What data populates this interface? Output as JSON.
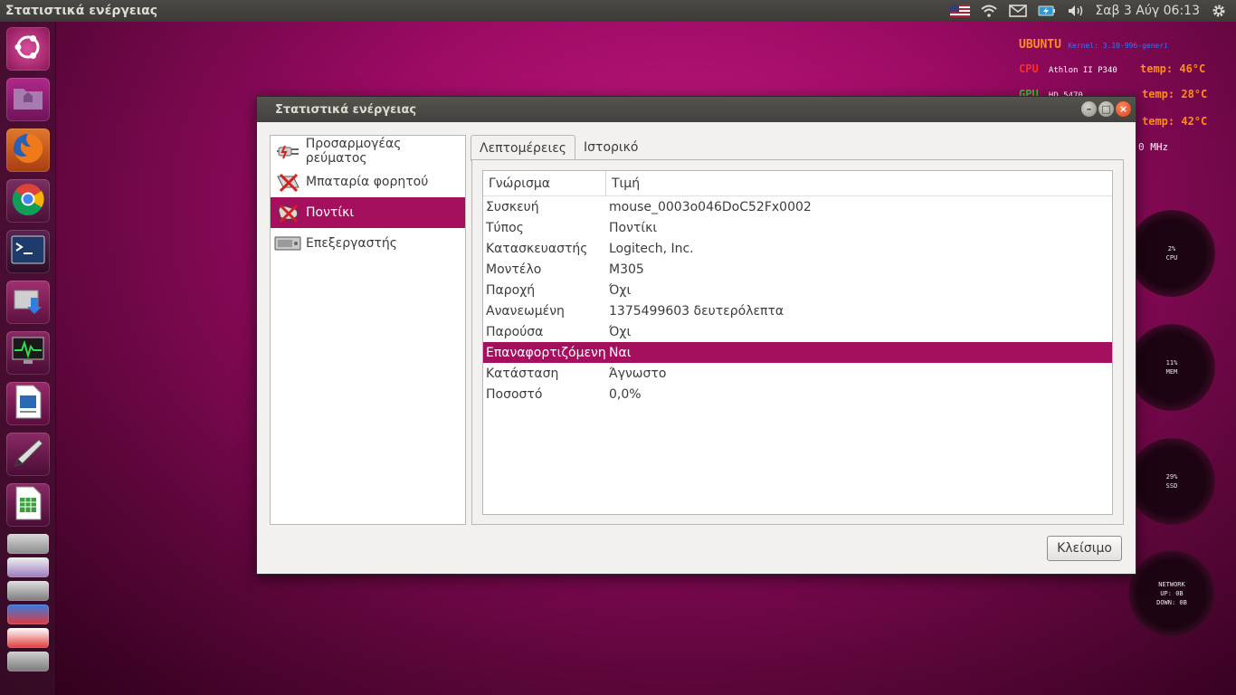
{
  "panel": {
    "title": "Στατιστικά ενέργειας",
    "clock": "Σαβ  3 Αύγ  06:13"
  },
  "conky": {
    "ubuntu": "UBUNTU",
    "kernel": "Kernel: 3.10-996-generi",
    "cpu_label": "CPU",
    "cpu_model": "Athlon II P340",
    "cpu_temp": "temp: 46°C",
    "gpu_label": "GPU",
    "gpu_model": "HD 5470",
    "gpu_temp": "temp: 28°C",
    "disk_temp": "temp: 42°C",
    "freq": "0 MHz",
    "rings": [
      {
        "value": "2%",
        "label": "CPU"
      },
      {
        "value": "11%",
        "label": "MEM"
      },
      {
        "value": "29%",
        "label": "SSD"
      }
    ],
    "network": {
      "title": "NETWORK",
      "up": "UP:",
      "up_val": "0B",
      "down": "DOWN:",
      "down_val": "0B"
    }
  },
  "dialog": {
    "title": "Στατιστικά ενέργειας",
    "devices": [
      {
        "label": "Προσαρμογέας ρεύματος",
        "icon": "power-plug-icon"
      },
      {
        "label": "Μπαταρία φορητού",
        "icon": "laptop-battery-icon"
      },
      {
        "label": "Ποντίκι",
        "icon": "mouse-battery-icon"
      },
      {
        "label": "Επεξεργαστής",
        "icon": "processor-icon"
      }
    ],
    "tabs": [
      "Λεπτομέρειες",
      "Ιστορικό"
    ],
    "columns": [
      "Γνώρισμα",
      "Τιμή"
    ],
    "rows": [
      {
        "attr": "Συσκευή",
        "value": "mouse_0003o046DoC52Fx0002"
      },
      {
        "attr": "Τύπος",
        "value": "Ποντίκι"
      },
      {
        "attr": "Κατασκευαστής",
        "value": "Logitech, Inc."
      },
      {
        "attr": "Μοντέλο",
        "value": "M305"
      },
      {
        "attr": "Παροχή",
        "value": "Όχι"
      },
      {
        "attr": "Ανανεωμένη",
        "value": "1375499603 δευτερόλεπτα"
      },
      {
        "attr": "Παρούσα",
        "value": "Όχι"
      },
      {
        "attr": "Επαναφορτιζόμενη",
        "value": "Ναι"
      },
      {
        "attr": "Κατάσταση",
        "value": "Άγνωστο"
      },
      {
        "attr": "Ποσοστό",
        "value": "0,0%"
      }
    ],
    "close_label": "Κλείσιμο"
  },
  "colors": {
    "selection": "#a4105e",
    "panel": "#3c3b37",
    "conky_accent": "#ff2b2b",
    "conky_orange": "#ff8c1a",
    "conky_green": "#1ed41e"
  }
}
